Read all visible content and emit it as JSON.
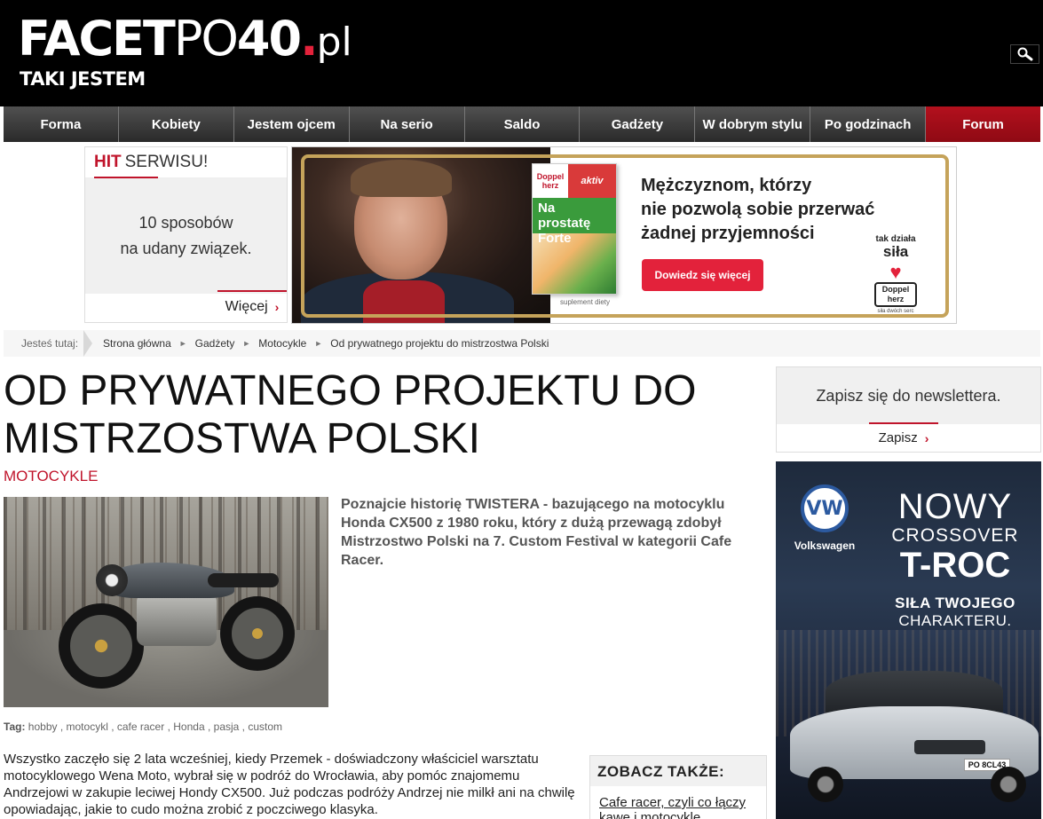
{
  "header": {
    "logo_part1": "FACET",
    "logo_part2": "PO",
    "logo_part3": "40",
    "logo_dot": ".",
    "logo_tld": "pl",
    "tagline": "TAKI JESTEM"
  },
  "nav": {
    "items": [
      "Forma",
      "Kobiety",
      "Jestem ojcem",
      "Na serio",
      "Saldo",
      "Gadżety",
      "W dobrym stylu",
      "Po godzinach",
      "Forum"
    ]
  },
  "hit": {
    "label_strong": "HIT",
    "label_rest": "SERWISU!",
    "text_line1": "10 sposobów",
    "text_line2": "na udany związek.",
    "more": "Więcej",
    "chevron": "›"
  },
  "ad_banner": {
    "box_brand": "Doppel herz",
    "box_aktiv": "aktiv",
    "box_name": "Na prostatę Forte",
    "suplement": "suplement diety",
    "headline_line1": "Mężczyznom, którzy",
    "headline_line2": "nie pozwolą sobie przerwać",
    "headline_line3": "żadnej przyjemności",
    "cta": "Dowiedz się więcej",
    "brand_line1": "tak działa",
    "brand_line2": "siła",
    "brand_logo": "Doppel herz",
    "brand_tag": "siła dwóch serc"
  },
  "breadcrumb": {
    "label": "Jesteś tutaj:",
    "items": [
      "Strona główna",
      "Gadżety",
      "Motocykle"
    ],
    "current": "Od prywatnego projektu do mistrzostwa Polski",
    "arrow": "►"
  },
  "article": {
    "title": "OD PRYWATNEGO PROJEKTU DO MISTRZOSTWA POLSKI",
    "category": "MOTOCYKLE",
    "lead": "Poznajcie historię TWISTERA - bazującego na motocyklu Honda CX500 z 1980 roku, który z dużą przewagą zdobył Mistrzostwo Polski na 7. Custom Festival w kategorii Cafe Racer.",
    "tags_label": "Tag:",
    "tags": [
      "hobby",
      "motocykl",
      "cafe racer",
      "Honda",
      "pasja",
      "custom"
    ],
    "body": "Wszystko zaczęło się 2 lata wcześniej, kiedy Przemek - doświadczony właściciel warsztatu motocyklowego Wena Moto, wybrał się w podróż do Wrocławia, aby pomóc znajomemu Andrzejowi w zakupie leciwej Hondy CX500. Już podczas podróży Andrzej nie milkł ani na chwilę opowiadając, jakie to cudo można zrobić z poczciwego klasyka."
  },
  "see_also": {
    "title": "ZOBACZ TAKŻE:",
    "link": "Cafe racer, czyli co łączy kawę i motocykle"
  },
  "newsletter": {
    "text": "Zapisz się do newslettera.",
    "button": "Zapisz",
    "chevron": "›"
  },
  "vw_ad": {
    "logo": "VW",
    "brand": "Volkswagen",
    "line1": "NOWY",
    "line2": "CROSSOVER",
    "line3": "T-ROC",
    "line4": "SIŁA TWOJEGO",
    "line5": "CHARAKTERU.",
    "plate": "PO 8CL43"
  },
  "colors": {
    "accent": "#c0142b",
    "header_bg": "#000000",
    "nav_bg": "#3a3a3a",
    "forum_bg": "#a50e19"
  }
}
